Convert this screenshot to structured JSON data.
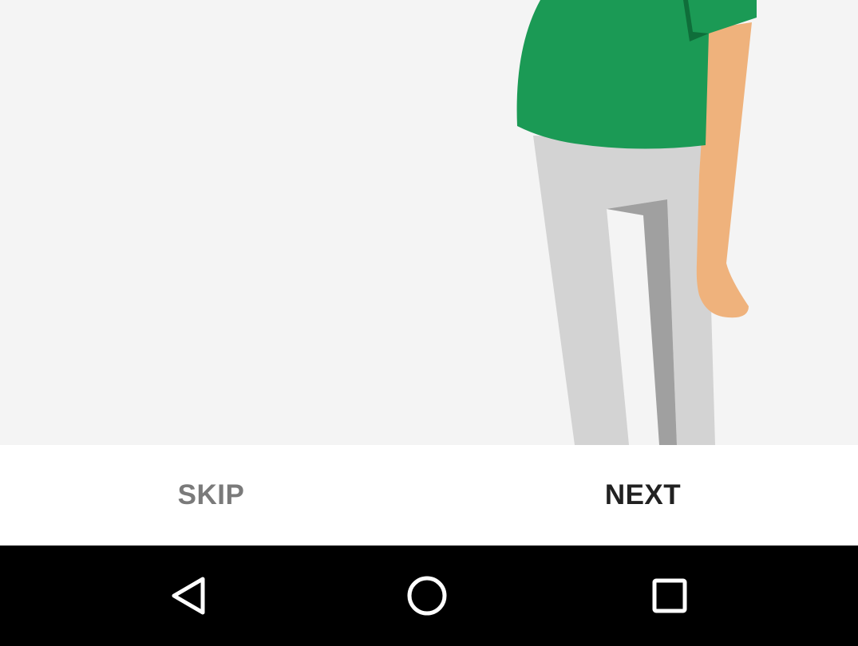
{
  "illustration": {
    "background_color": "#f4f4f4",
    "shirt_color": "#1b9a55",
    "shirt_shadow_color": "#0f6e3a",
    "skin_color": "#efb27c",
    "pants_color": "#d3d3d3",
    "pants_shadow_color": "#a0a0a0"
  },
  "actions": {
    "skip_label": "SKIP",
    "next_label": "NEXT"
  },
  "navigation_bar": {
    "back_icon": "back-triangle-icon",
    "home_icon": "home-circle-icon",
    "recents_icon": "recents-square-icon"
  }
}
